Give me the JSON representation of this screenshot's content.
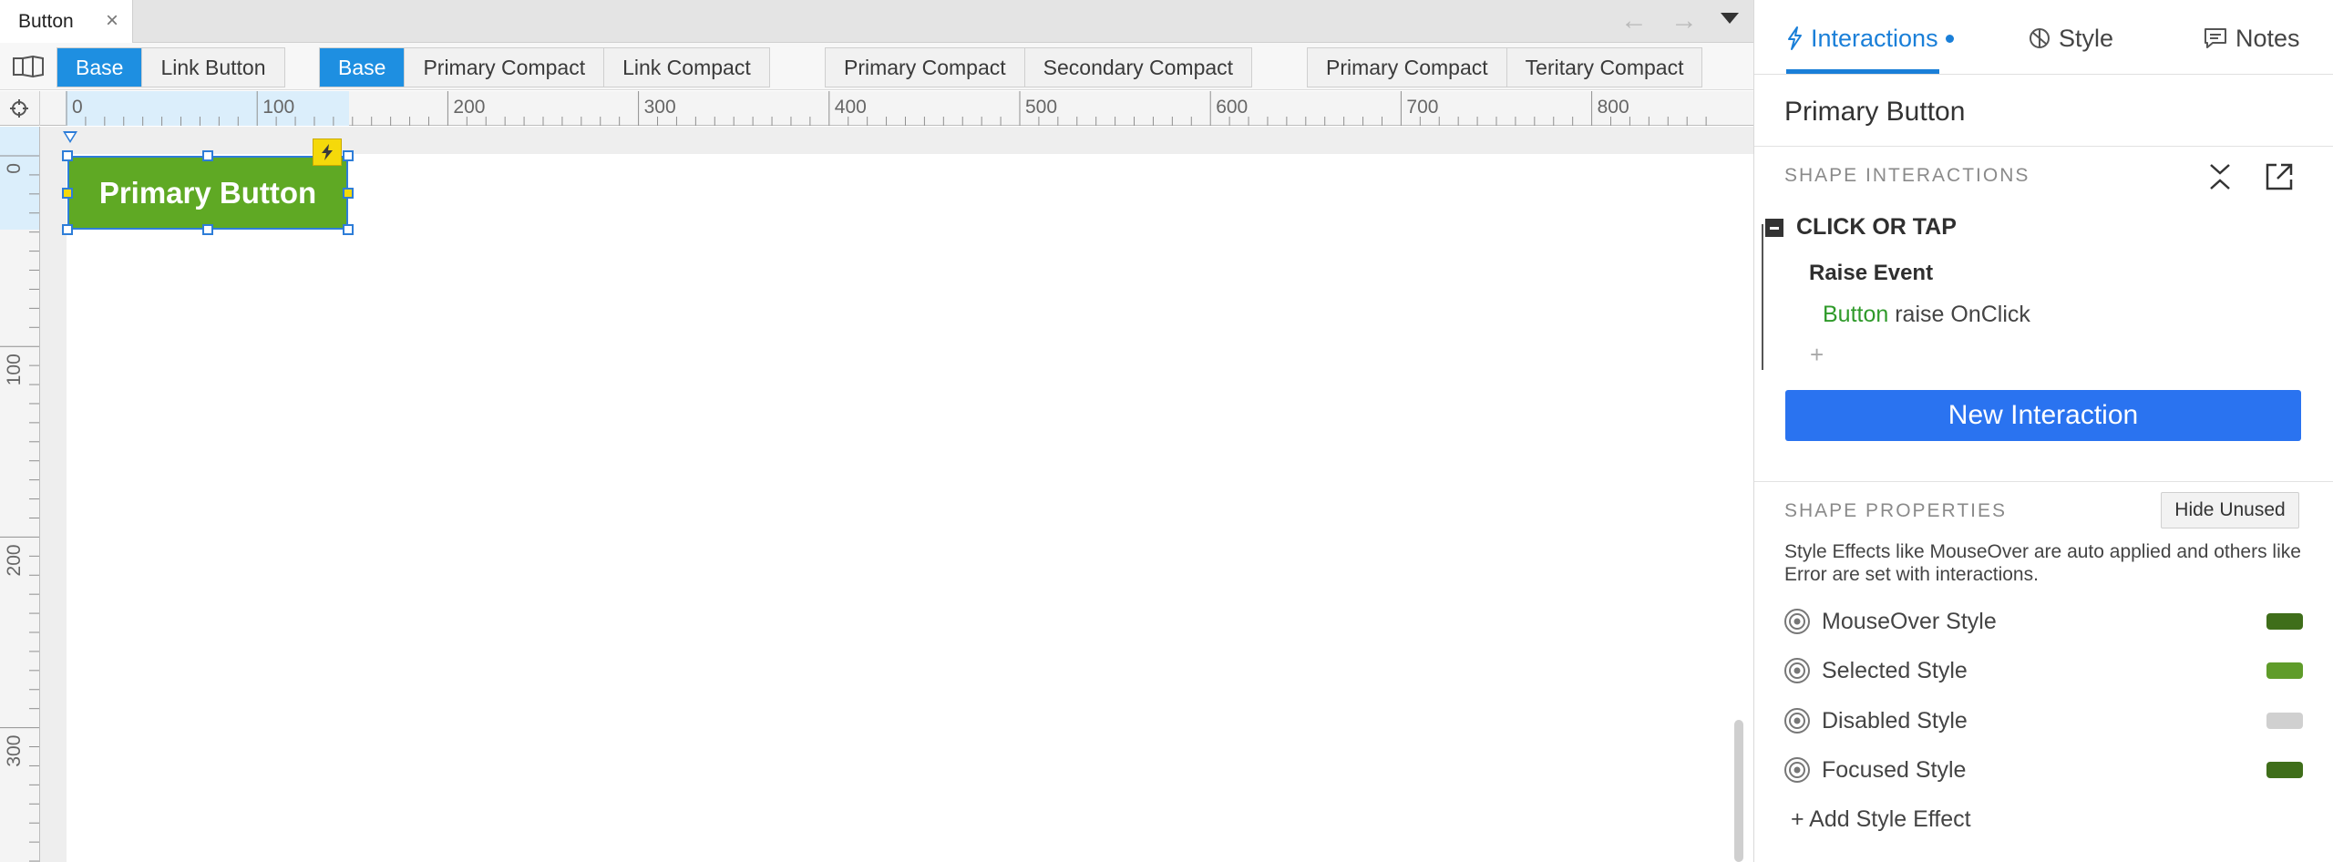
{
  "document_tab": {
    "title": "Button",
    "close_glyph": "×"
  },
  "navigation": {
    "back_glyph": "←",
    "forward_glyph": "→"
  },
  "state_groups": [
    {
      "items": [
        {
          "label": "Base",
          "active": true
        },
        {
          "label": "Link Button",
          "active": false
        }
      ]
    },
    {
      "items": [
        {
          "label": "Base",
          "active": true
        },
        {
          "label": "Primary Compact",
          "active": false
        },
        {
          "label": "Link Compact",
          "active": false
        }
      ]
    },
    {
      "items": [
        {
          "label": "Primary Compact",
          "active": false
        },
        {
          "label": "Secondary Compact",
          "active": false
        }
      ]
    },
    {
      "items": [
        {
          "label": "Primary Compact",
          "active": false
        },
        {
          "label": "Teritary Compact",
          "active": false
        }
      ]
    }
  ],
  "rulers": {
    "horizontal_labels": [
      "0",
      "100",
      "200",
      "300",
      "400",
      "500",
      "600",
      "700",
      "800"
    ],
    "vertical_labels": [
      "0",
      "100",
      "200",
      "300"
    ]
  },
  "canvas": {
    "widget_label": "Primary Button",
    "widget_color": "#5fa924",
    "selection_color": "#2d7dd8",
    "badge_color": "#f5d90a"
  },
  "panel": {
    "tabs": {
      "interactions": "Interactions",
      "style": "Style",
      "notes": "Notes"
    },
    "accent_color": "#1a7fd8",
    "shape_name": "Primary Button",
    "shape_interactions": {
      "header": "SHAPE INTERACTIONS",
      "event": "CLICK OR TAP",
      "action": "Raise Event",
      "target": "Button",
      "detail": "raise OnClick",
      "add_glyph": "+"
    },
    "new_interaction_label": "New Interaction",
    "new_interaction_color": "#2a73f0",
    "shape_properties": {
      "header": "SHAPE PROPERTIES",
      "hide_unused_label": "Hide Unused",
      "note": "Style Effects like MouseOver are auto applied and others like Error are set with interactions.",
      "styles": [
        {
          "label": "MouseOver Style",
          "color": "#3f6e1a"
        },
        {
          "label": "Selected Style",
          "color": "#5f9c2a"
        },
        {
          "label": "Disabled Style",
          "color": "#d0d0d0"
        },
        {
          "label": "Focused Style",
          "color": "#3f6e1a"
        }
      ],
      "add_style_effect_label": "+ Add Style Effect"
    }
  }
}
